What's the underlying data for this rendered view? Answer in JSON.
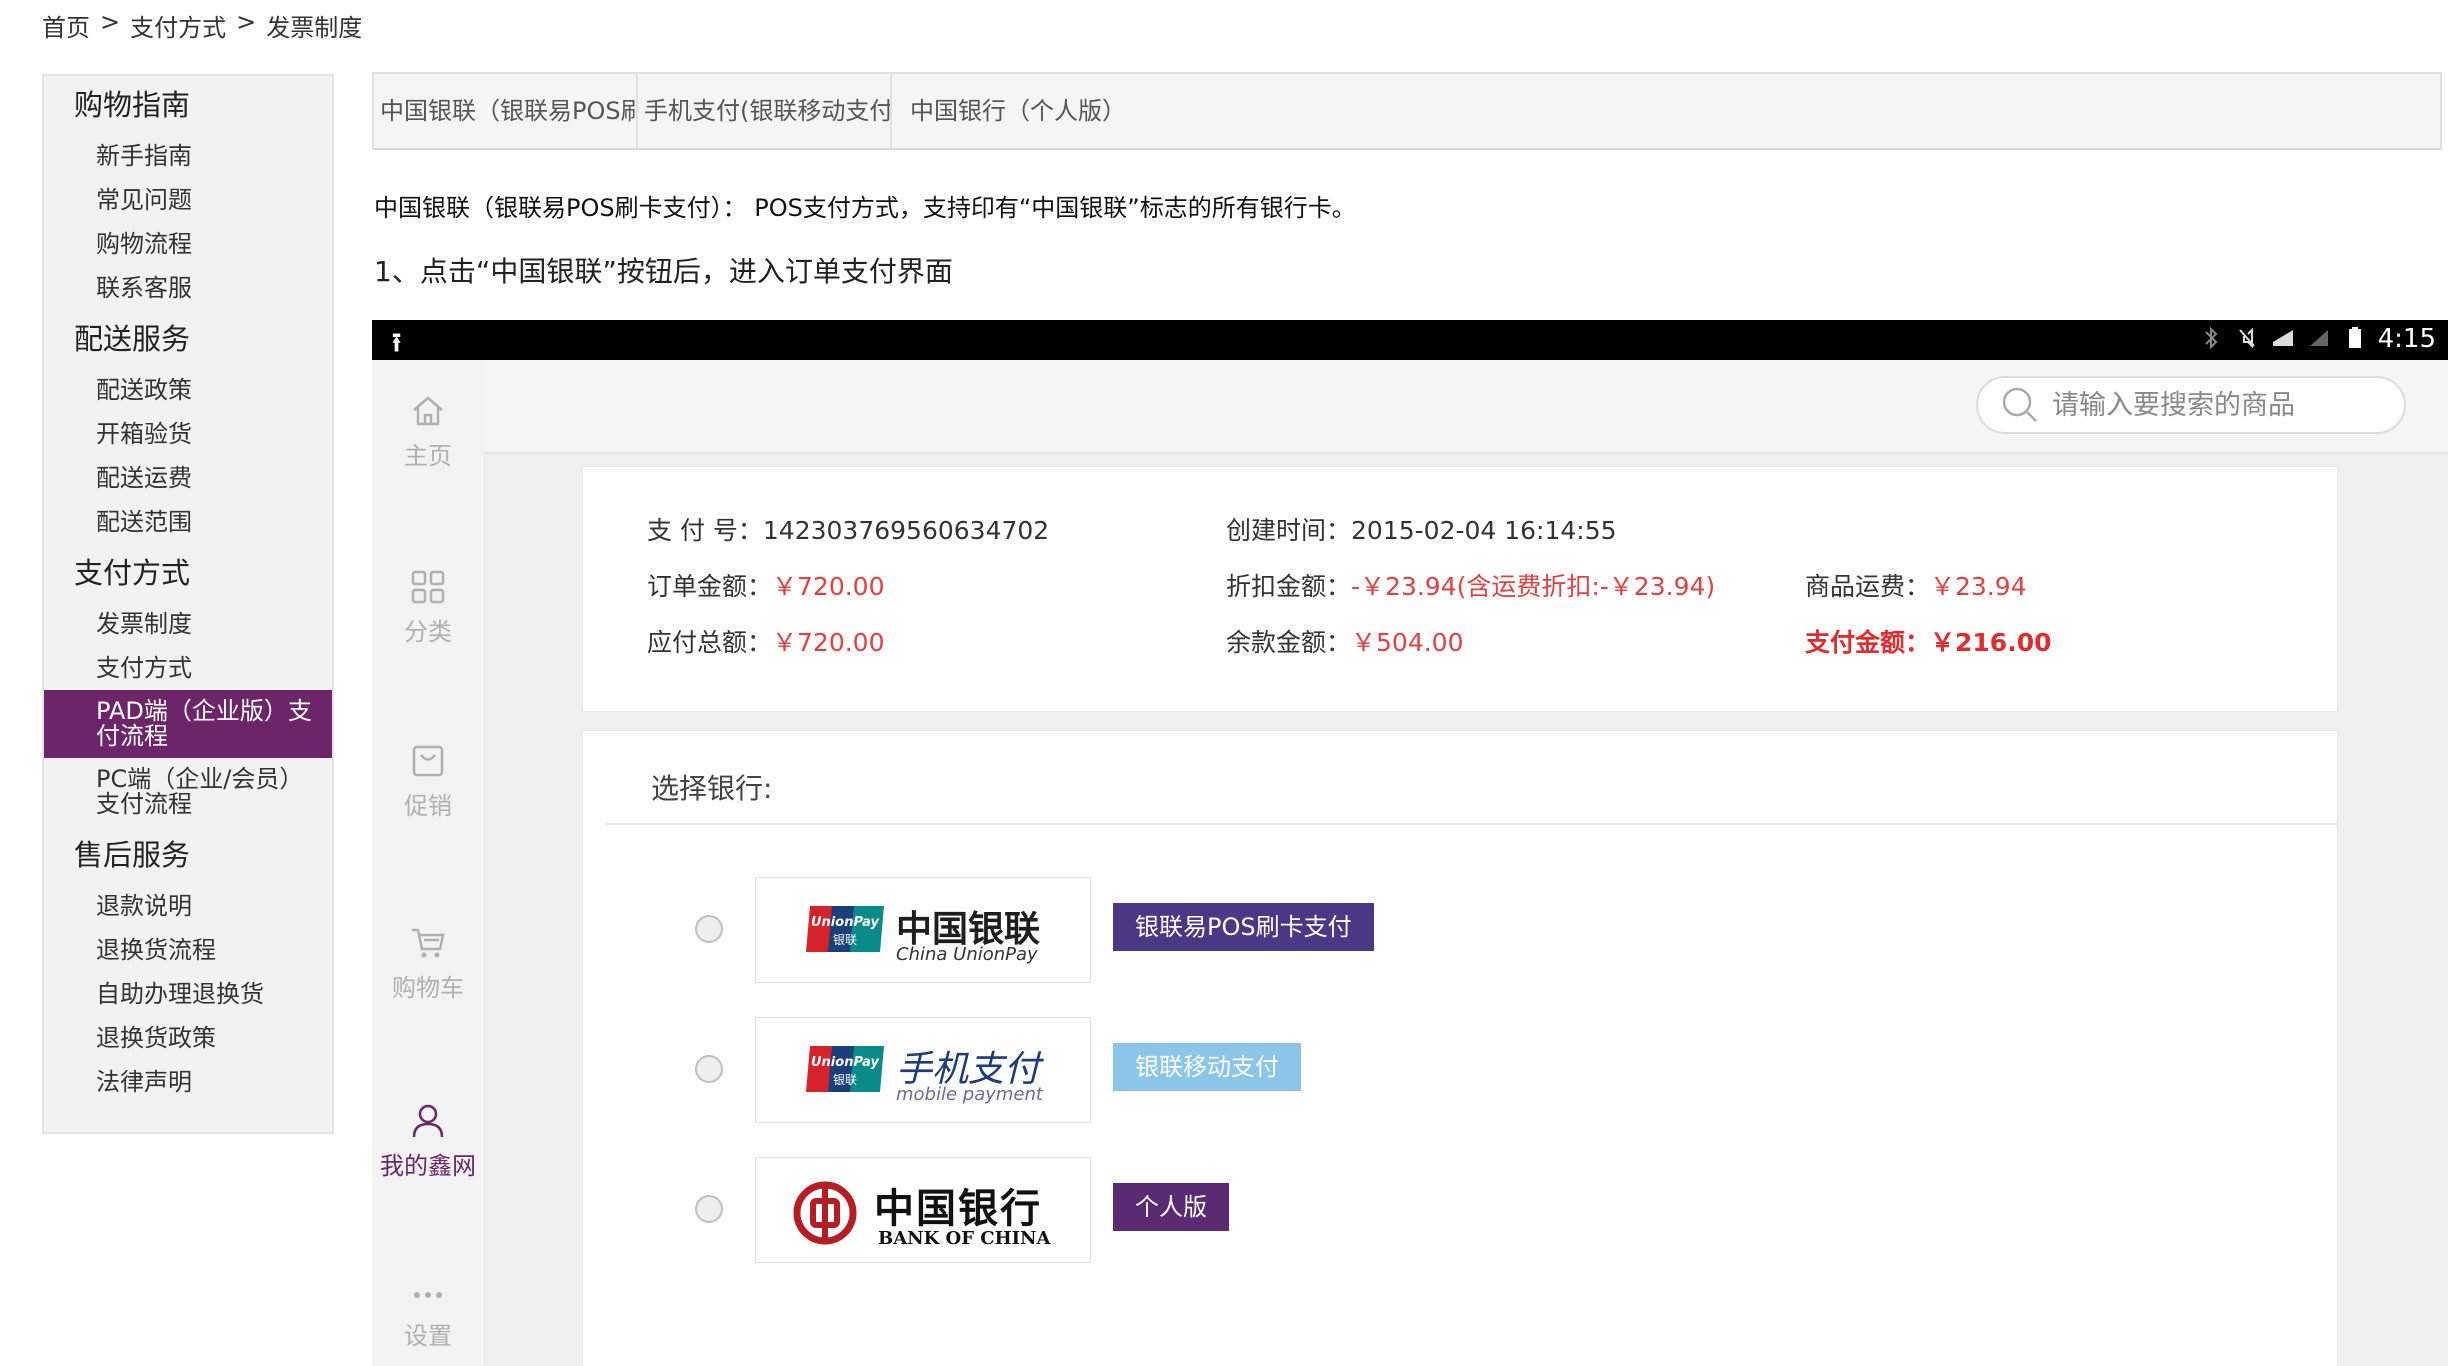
{
  "breadcrumb": [
    "首页",
    "支付方式",
    "发票制度"
  ],
  "sidebar": {
    "sections": [
      {
        "title": "购物指南",
        "items": [
          "新手指南",
          "常见问题",
          "购物流程",
          "联系客服"
        ]
      },
      {
        "title": "配送服务",
        "items": [
          "配送政策",
          "开箱验货",
          "配送运费",
          "配送范围"
        ]
      },
      {
        "title": "支付方式",
        "items": [
          "发票制度",
          "支付方式",
          "PAD端（企业版）支付流程",
          "PC端（企业/会员）支付流程"
        ]
      },
      {
        "title": "售后服务",
        "items": [
          "退款说明",
          "退换货流程",
          "自助办理退换货",
          "退换货政策",
          "法律声明"
        ]
      }
    ],
    "active_item": "PAD端（企业版）支付流程"
  },
  "tabs": [
    "中国银联（银联易POS刷卡支付）",
    "手机支付(银联移动支付)",
    "中国银行（个人版）"
  ],
  "content": {
    "desc": "中国银联（银联易POS刷卡支付）： POS支付方式，支持印有“中国银联”标志的所有银行卡。",
    "step1": "1、点击“中国银联”按钮后，进入订单支付界面"
  },
  "device": {
    "status_time": "4:15",
    "nav": [
      "主页",
      "分类",
      "促销",
      "购物车",
      "我的鑫网",
      "设置"
    ],
    "active_nav": "我的鑫网",
    "search_placeholder": "请输入要搜索的商品"
  },
  "order": {
    "pay_no_label": "支 付 号：",
    "pay_no": "142303769560634702",
    "created_label": "创建时间：",
    "created": "2015-02-04 16:14:55",
    "order_amount_label": "订单金额：",
    "order_amount": "￥720.00",
    "discount_label": "折扣金额：",
    "discount": "-￥23.94(含运费折扣:-￥23.94)",
    "freight_label": "商品运费：",
    "freight": "￥23.94",
    "total_label": "应付总额：",
    "total": "￥720.00",
    "balance_label": "余款金额：",
    "balance": "￥504.00",
    "pay_label": "支付金额：",
    "pay": "￥216.00"
  },
  "banks": {
    "title": "选择银行:",
    "rows": [
      {
        "logo_cn": "中国银联",
        "logo_en": "China UnionPay",
        "button": "银联易POS刷卡支付",
        "badge": "UnionPay 银联"
      },
      {
        "logo_cn": "手机支付",
        "logo_en": "mobile payment",
        "button": "银联移动支付",
        "badge": "UnionPay 银联"
      },
      {
        "logo_cn": "中国银行",
        "logo_en": "BANK OF CHINA",
        "button": "个人版"
      }
    ]
  },
  "colors": {
    "accent_purple": "#6d2569",
    "price_red": "#e34141",
    "button_purple": "#4b3784",
    "button_light_blue": "#8bc6e9"
  }
}
